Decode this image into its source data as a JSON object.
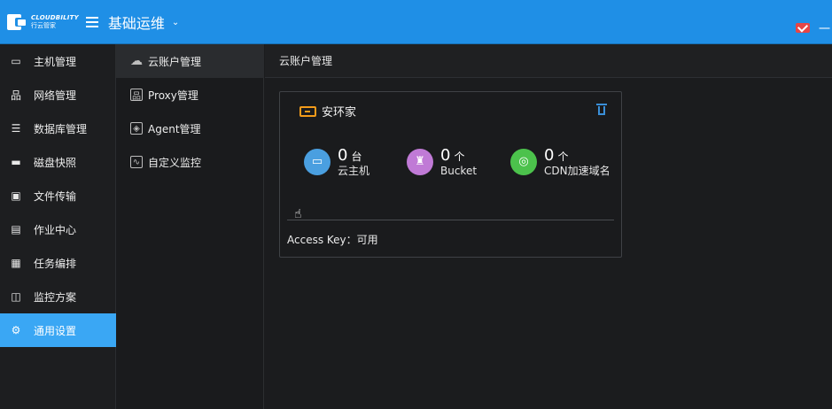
{
  "topbar": {
    "logo_en": "CLOUDBILITY",
    "logo_cn": "行云管家",
    "app_title": "基础运维",
    "user_partial": "一",
    "accent": "#1f8fe6"
  },
  "sidebar": {
    "items": [
      {
        "label": "主机管理",
        "icon": "monitor-icon"
      },
      {
        "label": "网络管理",
        "icon": "network-icon"
      },
      {
        "label": "数据库管理",
        "icon": "database-icon"
      },
      {
        "label": "磁盘快照",
        "icon": "disk-icon"
      },
      {
        "label": "文件传输",
        "icon": "file-transfer-icon"
      },
      {
        "label": "作业中心",
        "icon": "job-icon"
      },
      {
        "label": "任务编排",
        "icon": "task-icon"
      },
      {
        "label": "监控方案",
        "icon": "monitor-plan-icon"
      },
      {
        "label": "通用设置",
        "icon": "gear-icon",
        "active": true
      }
    ]
  },
  "subnav": {
    "items": [
      {
        "label": "云账户管理",
        "icon": "cloud-icon",
        "active": true
      },
      {
        "label": "Proxy管理",
        "icon": "proxy-icon"
      },
      {
        "label": "Agent管理",
        "icon": "agent-icon"
      },
      {
        "label": "自定义监控",
        "icon": "custom-monitor-icon"
      }
    ]
  },
  "content": {
    "header": "云账户管理",
    "card": {
      "title": "安环家",
      "stats": [
        {
          "value": "0",
          "unit": "台",
          "label": "云主机",
          "color": "#4a9fe0",
          "icon": "server-icon"
        },
        {
          "value": "0",
          "unit": "个",
          "label": "Bucket",
          "color": "#c07ad6",
          "icon": "bucket-icon"
        },
        {
          "value": "0",
          "unit": "个",
          "label": "CDN加速域名",
          "color": "#4cc24c",
          "icon": "globe-icon"
        }
      ],
      "access_key": "Access Key：可用"
    }
  }
}
